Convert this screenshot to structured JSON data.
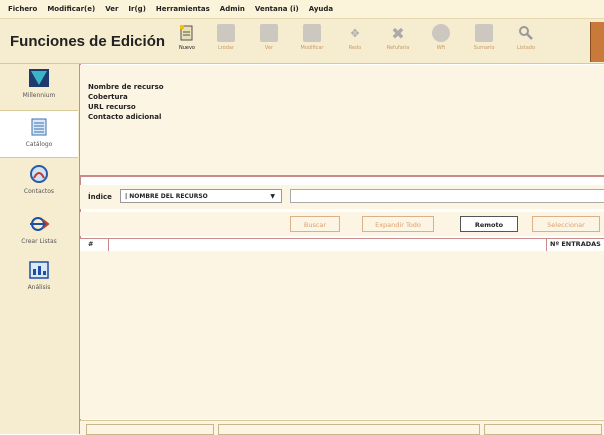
{
  "menubar": {
    "items": [
      "Fichero",
      "Modificar(e)",
      "Ver",
      "Ir(g)",
      "Herramientas",
      "Admin",
      "Ventana (i)",
      "Ayuda"
    ]
  },
  "toolbar": {
    "title": "Funciones de Edición",
    "buttons": [
      {
        "label": "Nuevo",
        "icon": "new-document-icon",
        "enabled": true
      },
      {
        "label": "Lrodar",
        "icon": "list-icon",
        "enabled": false
      },
      {
        "label": "Ver",
        "icon": "view-icon",
        "enabled": false
      },
      {
        "label": "Modificar",
        "icon": "edit-icon",
        "enabled": false
      },
      {
        "label": "Redo",
        "icon": "diamond-arrows-icon",
        "enabled": false
      },
      {
        "label": "Refufaria",
        "icon": "x-delete-icon",
        "enabled": false
      },
      {
        "label": "Wft",
        "icon": "globe-icon",
        "enabled": false
      },
      {
        "label": "Sumario",
        "icon": "summary-icon",
        "enabled": false
      },
      {
        "label": "Listado",
        "icon": "search-icon",
        "enabled": false
      }
    ]
  },
  "sidebar": {
    "items": [
      {
        "label": "Millennium",
        "icon": "millennium-logo-icon",
        "selected": false
      },
      {
        "label": "Catálogo",
        "icon": "catalog-icon",
        "selected": true
      },
      {
        "label": "Contactos",
        "icon": "contacts-icon",
        "selected": false
      },
      {
        "label": "Crear Listas",
        "icon": "create-lists-icon",
        "selected": false
      },
      {
        "label": "Análisis",
        "icon": "analysis-icon",
        "selected": false
      }
    ]
  },
  "info": {
    "lines": [
      "Nombre de recurso",
      "Cobertura",
      "URL recurso",
      "Contacto adicional"
    ]
  },
  "search": {
    "index_label": "Índice",
    "index_selected": "| NOMBRE DEL RECURSO",
    "query": ""
  },
  "actions": {
    "buscar": "Buscar",
    "expandir": "Expandir Todo",
    "remoto": "Remoto",
    "seleccionar": "Seleccionar"
  },
  "table": {
    "col_hash": "#",
    "col_entradas": "Nº ENTRADAS"
  }
}
